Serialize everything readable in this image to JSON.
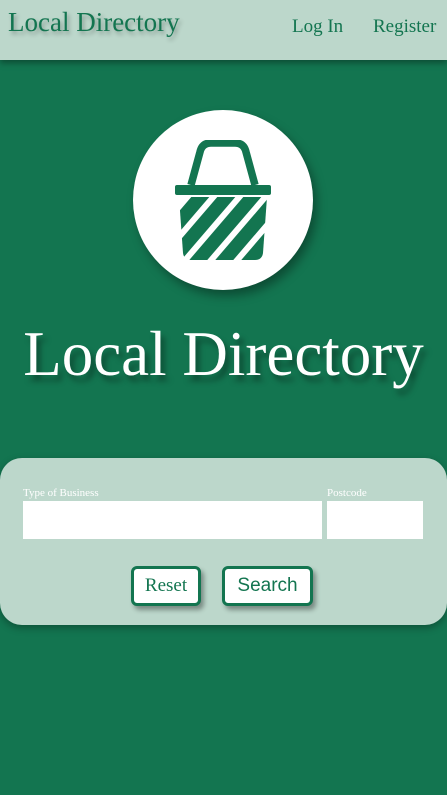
{
  "header": {
    "brand": "Local Directory",
    "nav": {
      "login_label": "Log In",
      "register_label": "Register"
    }
  },
  "hero": {
    "logo_icon": "basket-icon",
    "title": "Local Directory"
  },
  "search": {
    "type_label": "Type of Business",
    "type_value": "",
    "postcode_label": "Postcode",
    "postcode_value": "",
    "reset_label": "Reset",
    "search_label": "Search"
  },
  "colors": {
    "primary_green": "#137550",
    "light_panel": "#bcd7cb",
    "white": "#ffffff"
  }
}
